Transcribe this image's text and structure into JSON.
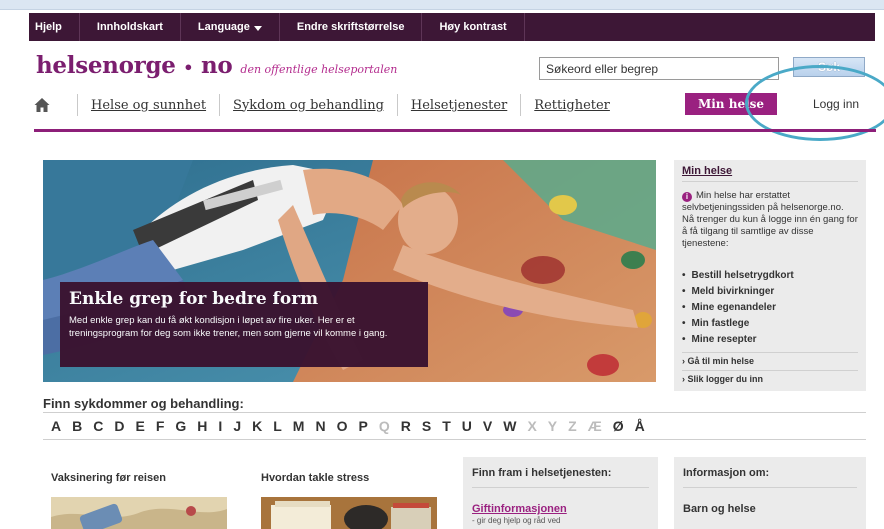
{
  "topbar": {
    "items": [
      "Hjelp",
      "Innholdskart",
      "Language",
      "Endre skriftstørrelse",
      "Høy kontrast"
    ]
  },
  "logo": {
    "name": "helsenorge",
    "dot": "•",
    "suffix": "no",
    "tagline": "den offentlige helseportalen"
  },
  "search": {
    "placeholder": "Søkeord eller begrep",
    "button_label": "Søk"
  },
  "nav": {
    "items": [
      "Helse og sunnhet",
      "Sykdom og behandling",
      "Helsetjenester",
      "Rettigheter"
    ],
    "min_helse_label": "Min helse",
    "login_label": "Logg inn"
  },
  "hero": {
    "title": "Enkle grep for bedre form",
    "text": "Med enkle grep kan du få økt kondisjon i løpet av fire uker. Her er et treningsprogram for deg som ikke trener, men som gjerne vil komme i gang."
  },
  "sidebar": {
    "title": "Min helse",
    "info": "Min helse har erstattet selvbetjeningssiden på helsenorge.no. Nå trenger du kun å logge inn én gang for å få tilgang til samtlige av disse tjenestene:",
    "services": [
      "Bestill helsetrygdkort",
      "Meld bivirkninger",
      "Mine egenandeler",
      "Min fastlege",
      "Mine resepter"
    ],
    "links": [
      "› Gå til min helse",
      "› Slik logger du inn"
    ]
  },
  "alphabet": {
    "title": "Finn sykdommer og behandling:",
    "letters": [
      "A",
      "B",
      "C",
      "D",
      "E",
      "F",
      "G",
      "H",
      "I",
      "J",
      "K",
      "L",
      "M",
      "N",
      "O",
      "P",
      "Q",
      "R",
      "S",
      "T",
      "U",
      "V",
      "W",
      "X",
      "Y",
      "Z",
      "Æ",
      "Ø",
      "Å"
    ],
    "disabled": [
      "Q",
      "X",
      "Y",
      "Z",
      "Æ"
    ]
  },
  "cards": {
    "vaksinering": "Vaksinering før reisen",
    "stress": "Hvordan takle stress",
    "finn_fram": {
      "title": "Finn fram i helsetjenesten:",
      "link": "Giftinformasjonen",
      "sub": "- gir deg hjelp og råd ved"
    },
    "informasjon": {
      "title": "Informasjon om:",
      "item": "Barn og helse"
    }
  },
  "colors": {
    "topbar": "#3d1736",
    "brand": "#9a2180",
    "highlight": "#4aa9c7"
  }
}
